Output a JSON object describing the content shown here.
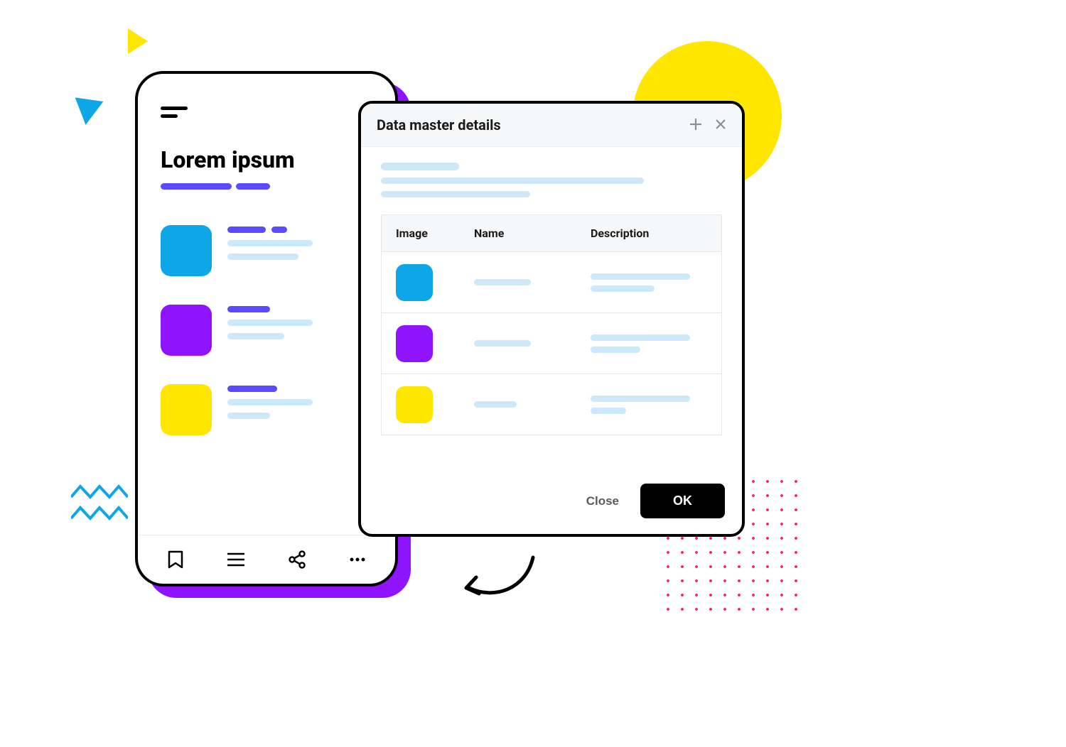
{
  "phone": {
    "title": "Lorem ipsum",
    "list_colors": [
      "blue",
      "purple",
      "yellow"
    ]
  },
  "dialog": {
    "title": "Data master details",
    "columns": {
      "image": "Image",
      "name": "Name",
      "description": "Description"
    },
    "rows": [
      {
        "color": "blue"
      },
      {
        "color": "purple"
      },
      {
        "color": "yellow"
      }
    ],
    "close_label": "Close",
    "ok_label": "OK"
  },
  "colors": {
    "blue": "#0DA6E6",
    "purple": "#9013FE",
    "yellow": "#FFE600",
    "accent": "#5B4BFF",
    "soft": "#CDE8F8"
  }
}
